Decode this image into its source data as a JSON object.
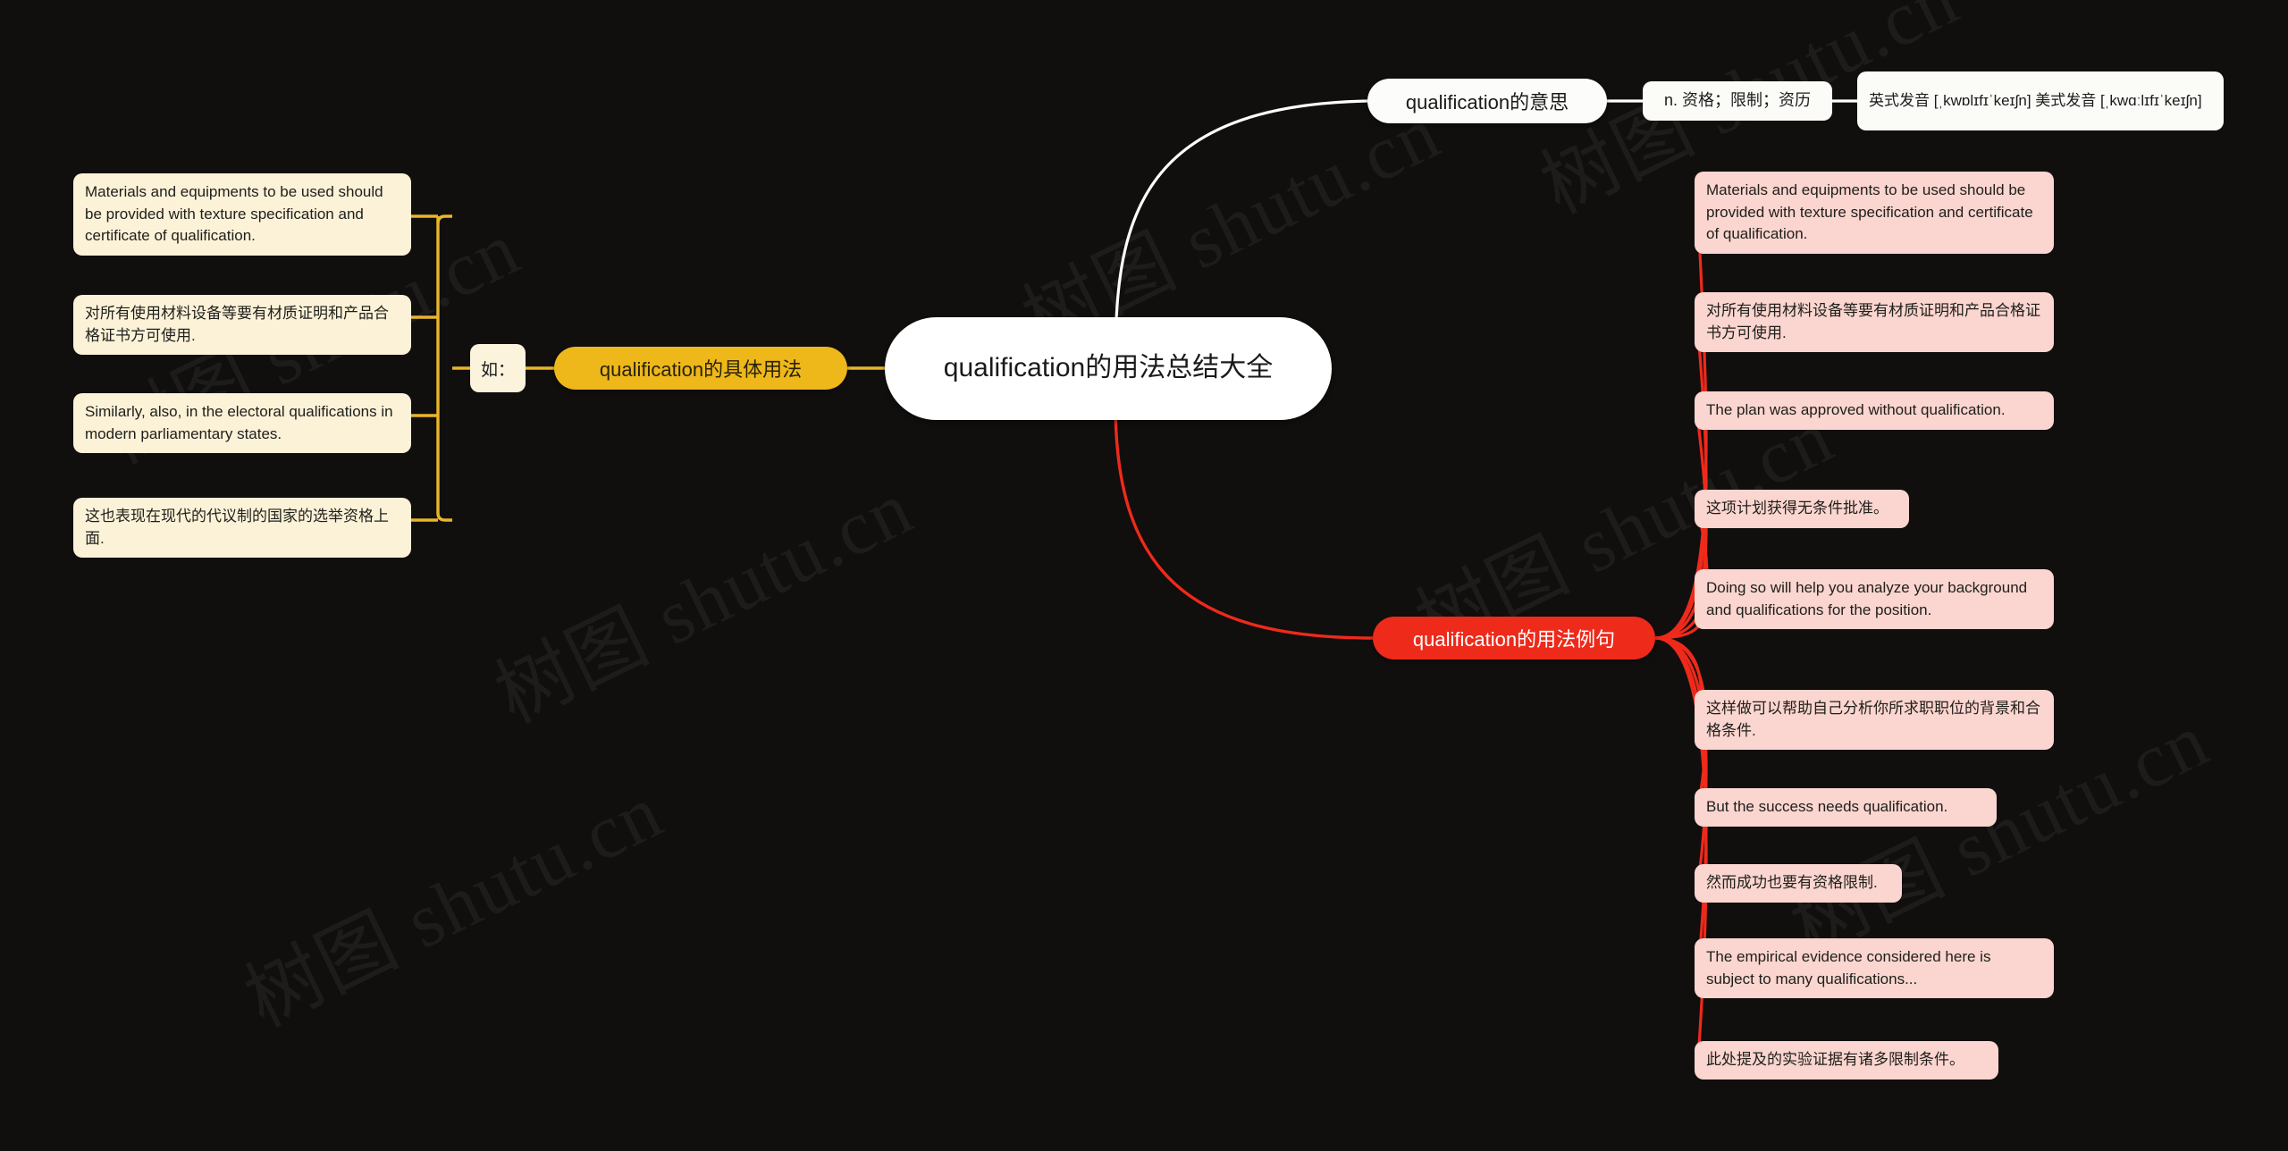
{
  "canvas": {
    "background_color": "#110e0e",
    "watermark_text": "树图 shutu.cn"
  },
  "colors": {
    "root_fill": "#ffffff",
    "yellow_branch": "#eeb81b",
    "red_branch": "#ee2a1b",
    "cream_leaf": "#fcf2d8",
    "pink_leaf": "#fbd5cf",
    "white_leaf": "#fbfbf8",
    "yellow_link": "#e8b62a",
    "red_link": "#ee2a1b",
    "white_link": "#ffffff"
  },
  "root": {
    "label": "qualification的用法总结大全"
  },
  "meaning_branch": {
    "label": "qualification的意思",
    "definition": "n. 资格；限制；资历",
    "pronunciation": "英式发音 [ˌkwɒlɪfɪˈkeɪʃn] 美式发音 [ˌkwɑːlɪfɪˈkeɪʃn]"
  },
  "usage_branch": {
    "label": "qualification的具体用法",
    "connector_tag": "如：",
    "items": [
      "Materials and equipments to be used should be provided with texture specification and certificate of qualification.",
      "对所有使用材料设备等要有材质证明和产品合格证书方可使用.",
      "Similarly, also, in the electoral qualifications in modern parliamentary states.",
      "这也表现在现代的代议制的国家的选举资格上面."
    ]
  },
  "examples_branch": {
    "label": "qualification的用法例句",
    "items": [
      "Materials and equipments to be used should be provided with texture specification and certificate of qualification.",
      "对所有使用材料设备等要有材质证明和产品合格证书方可使用.",
      "The plan was approved without qualification.",
      "这项计划获得无条件批准。",
      "Doing so will help you analyze your background and qualifications for the position.",
      "这样做可以帮助自己分析你所求职职位的背景和合格条件.",
      "But the success needs qualification.",
      "然而成功也要有资格限制.",
      "The empirical evidence considered here is subject to many qualifications...",
      "此处提及的实验证据有诸多限制条件。"
    ]
  }
}
